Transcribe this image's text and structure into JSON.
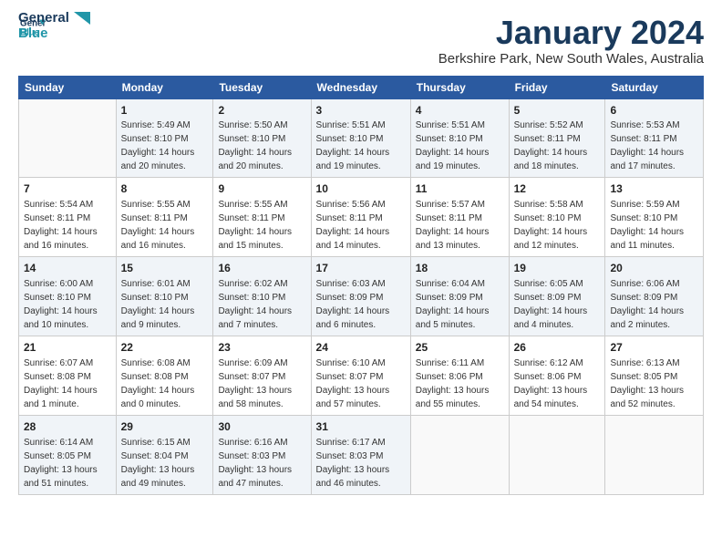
{
  "logo": {
    "line1": "General",
    "line2": "Blue"
  },
  "title": "January 2024",
  "subtitle": "Berkshire Park, New South Wales, Australia",
  "headers": [
    "Sunday",
    "Monday",
    "Tuesday",
    "Wednesday",
    "Thursday",
    "Friday",
    "Saturday"
  ],
  "weeks": [
    [
      {
        "day": "",
        "info": ""
      },
      {
        "day": "1",
        "info": "Sunrise: 5:49 AM\nSunset: 8:10 PM\nDaylight: 14 hours\nand 20 minutes."
      },
      {
        "day": "2",
        "info": "Sunrise: 5:50 AM\nSunset: 8:10 PM\nDaylight: 14 hours\nand 20 minutes."
      },
      {
        "day": "3",
        "info": "Sunrise: 5:51 AM\nSunset: 8:10 PM\nDaylight: 14 hours\nand 19 minutes."
      },
      {
        "day": "4",
        "info": "Sunrise: 5:51 AM\nSunset: 8:10 PM\nDaylight: 14 hours\nand 19 minutes."
      },
      {
        "day": "5",
        "info": "Sunrise: 5:52 AM\nSunset: 8:11 PM\nDaylight: 14 hours\nand 18 minutes."
      },
      {
        "day": "6",
        "info": "Sunrise: 5:53 AM\nSunset: 8:11 PM\nDaylight: 14 hours\nand 17 minutes."
      }
    ],
    [
      {
        "day": "7",
        "info": "Sunrise: 5:54 AM\nSunset: 8:11 PM\nDaylight: 14 hours\nand 16 minutes."
      },
      {
        "day": "8",
        "info": "Sunrise: 5:55 AM\nSunset: 8:11 PM\nDaylight: 14 hours\nand 16 minutes."
      },
      {
        "day": "9",
        "info": "Sunrise: 5:55 AM\nSunset: 8:11 PM\nDaylight: 14 hours\nand 15 minutes."
      },
      {
        "day": "10",
        "info": "Sunrise: 5:56 AM\nSunset: 8:11 PM\nDaylight: 14 hours\nand 14 minutes."
      },
      {
        "day": "11",
        "info": "Sunrise: 5:57 AM\nSunset: 8:11 PM\nDaylight: 14 hours\nand 13 minutes."
      },
      {
        "day": "12",
        "info": "Sunrise: 5:58 AM\nSunset: 8:10 PM\nDaylight: 14 hours\nand 12 minutes."
      },
      {
        "day": "13",
        "info": "Sunrise: 5:59 AM\nSunset: 8:10 PM\nDaylight: 14 hours\nand 11 minutes."
      }
    ],
    [
      {
        "day": "14",
        "info": "Sunrise: 6:00 AM\nSunset: 8:10 PM\nDaylight: 14 hours\nand 10 minutes."
      },
      {
        "day": "15",
        "info": "Sunrise: 6:01 AM\nSunset: 8:10 PM\nDaylight: 14 hours\nand 9 minutes."
      },
      {
        "day": "16",
        "info": "Sunrise: 6:02 AM\nSunset: 8:10 PM\nDaylight: 14 hours\nand 7 minutes."
      },
      {
        "day": "17",
        "info": "Sunrise: 6:03 AM\nSunset: 8:09 PM\nDaylight: 14 hours\nand 6 minutes."
      },
      {
        "day": "18",
        "info": "Sunrise: 6:04 AM\nSunset: 8:09 PM\nDaylight: 14 hours\nand 5 minutes."
      },
      {
        "day": "19",
        "info": "Sunrise: 6:05 AM\nSunset: 8:09 PM\nDaylight: 14 hours\nand 4 minutes."
      },
      {
        "day": "20",
        "info": "Sunrise: 6:06 AM\nSunset: 8:09 PM\nDaylight: 14 hours\nand 2 minutes."
      }
    ],
    [
      {
        "day": "21",
        "info": "Sunrise: 6:07 AM\nSunset: 8:08 PM\nDaylight: 14 hours\nand 1 minute."
      },
      {
        "day": "22",
        "info": "Sunrise: 6:08 AM\nSunset: 8:08 PM\nDaylight: 14 hours\nand 0 minutes."
      },
      {
        "day": "23",
        "info": "Sunrise: 6:09 AM\nSunset: 8:07 PM\nDaylight: 13 hours\nand 58 minutes."
      },
      {
        "day": "24",
        "info": "Sunrise: 6:10 AM\nSunset: 8:07 PM\nDaylight: 13 hours\nand 57 minutes."
      },
      {
        "day": "25",
        "info": "Sunrise: 6:11 AM\nSunset: 8:06 PM\nDaylight: 13 hours\nand 55 minutes."
      },
      {
        "day": "26",
        "info": "Sunrise: 6:12 AM\nSunset: 8:06 PM\nDaylight: 13 hours\nand 54 minutes."
      },
      {
        "day": "27",
        "info": "Sunrise: 6:13 AM\nSunset: 8:05 PM\nDaylight: 13 hours\nand 52 minutes."
      }
    ],
    [
      {
        "day": "28",
        "info": "Sunrise: 6:14 AM\nSunset: 8:05 PM\nDaylight: 13 hours\nand 51 minutes."
      },
      {
        "day": "29",
        "info": "Sunrise: 6:15 AM\nSunset: 8:04 PM\nDaylight: 13 hours\nand 49 minutes."
      },
      {
        "day": "30",
        "info": "Sunrise: 6:16 AM\nSunset: 8:03 PM\nDaylight: 13 hours\nand 47 minutes."
      },
      {
        "day": "31",
        "info": "Sunrise: 6:17 AM\nSunset: 8:03 PM\nDaylight: 13 hours\nand 46 minutes."
      },
      {
        "day": "",
        "info": ""
      },
      {
        "day": "",
        "info": ""
      },
      {
        "day": "",
        "info": ""
      }
    ]
  ]
}
